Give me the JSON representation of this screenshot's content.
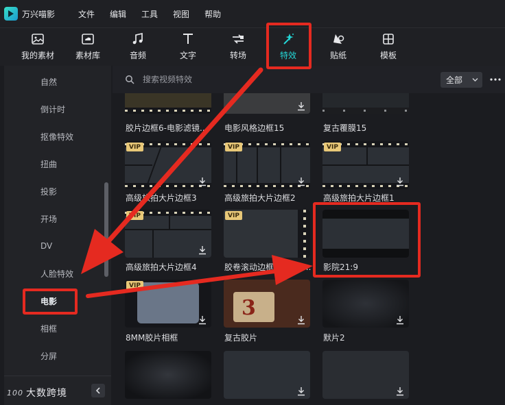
{
  "app": {
    "name": "万兴喵影"
  },
  "menu": [
    "文件",
    "编辑",
    "工具",
    "视图",
    "帮助"
  ],
  "toolbar": [
    {
      "label": "我的素材",
      "icon": "image-icon"
    },
    {
      "label": "素材库",
      "icon": "cloud-folder-icon"
    },
    {
      "label": "音频",
      "icon": "music-note-icon"
    },
    {
      "label": "文字",
      "icon": "text-t-icon"
    },
    {
      "label": "转场",
      "icon": "transition-arrows-icon"
    },
    {
      "label": "特效",
      "icon": "sparkle-wand-icon",
      "active": true
    },
    {
      "label": "贴纸",
      "icon": "sticker-icon"
    },
    {
      "label": "模板",
      "icon": "template-icon"
    }
  ],
  "sidebar": {
    "items": [
      {
        "label": "自然"
      },
      {
        "label": "倒计时"
      },
      {
        "label": "抠像特效"
      },
      {
        "label": "扭曲"
      },
      {
        "label": "投影"
      },
      {
        "label": "开场"
      },
      {
        "label": "DV"
      },
      {
        "label": "人脸特效"
      },
      {
        "label": "电影",
        "active": true
      },
      {
        "label": "相框"
      },
      {
        "label": "分屏"
      }
    ],
    "watermark_logo": "100",
    "watermark_text": "大数跨境"
  },
  "search": {
    "placeholder": "搜索视频特效"
  },
  "filter": {
    "value": "全部"
  },
  "cards": [
    {
      "title": "胶片边框6-电影滤镜...",
      "vip": false
    },
    {
      "title": "电影风格边框15",
      "vip": false
    },
    {
      "title": "复古覆膜15",
      "vip": false
    },
    {
      "title": "高级旅拍大片边框3",
      "vip": true
    },
    {
      "title": "高级旅拍大片边框2",
      "vip": true
    },
    {
      "title": "高级旅拍大片边框1",
      "vip": true
    },
    {
      "title": "高级旅拍大片边框4",
      "vip": true
    },
    {
      "title": "胶卷滚动边框-16mm...",
      "vip": true
    },
    {
      "title": "影院21:9",
      "vip": false
    },
    {
      "title": "8MM胶片相框",
      "vip": true
    },
    {
      "title": "复古胶片",
      "vip": false
    },
    {
      "title": "默片2",
      "vip": false
    },
    {
      "title": "",
      "vip": false
    },
    {
      "title": "",
      "vip": false
    },
    {
      "title": "",
      "vip": false
    }
  ],
  "vip_label": "VIP",
  "colors": {
    "accent": "#24d6d6",
    "highlight": "#e52a20",
    "vip": "#e8c878",
    "background": "#1b1c20"
  }
}
